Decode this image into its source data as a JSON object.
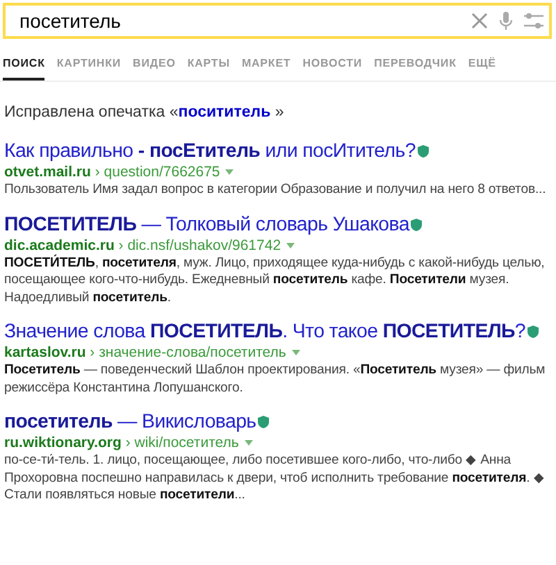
{
  "search": {
    "value": "посетитель"
  },
  "tabs": [
    {
      "label": "ПОИСК",
      "selected": true
    },
    {
      "label": "КАРТИНКИ",
      "selected": false
    },
    {
      "label": "ВИДЕО",
      "selected": false
    },
    {
      "label": "КАРТЫ",
      "selected": false
    },
    {
      "label": "МАРКЕТ",
      "selected": false
    },
    {
      "label": "НОВОСТИ",
      "selected": false
    },
    {
      "label": "ПЕРЕВОДЧИК",
      "selected": false
    },
    {
      "label": "ЕЩЁ",
      "selected": false
    }
  ],
  "correction": {
    "text": "Исправлена опечатка «",
    "query": "посититель",
    "end": " »"
  },
  "results": [
    {
      "title": "Как правильно **- посЕтитель** или посИтитель?",
      "url": "**otvet.mail.ru** › question/7662675",
      "snippet": "Пользователь Имя задал вопрос в категории Образование и получил на него 8 ответов..."
    },
    {
      "title": "**ПОСЕТИТЕЛЬ** — Толковый словарь Ушакова",
      "url": "**dic.academic.ru** › dic.nsf/ushakov/961742",
      "snippet": "**ПОСЕТИ́ТЕЛЬ**, **посетителя**, муж. Лицо, приходящее куда-нибудь с какой-нибудь целью, посещающее кого-что-нибудь. Ежедневный **посетитель** кафе. **Посетители** музея. Надоедливый **посетитель**."
    },
    {
      "title": "Значение слова **ПОСЕТИТЕЛЬ**. Что такое **ПОСЕТИТЕЛЬ**?",
      "url": "**kartaslov.ru** › значение-слова/посетитель",
      "snippet": "**Посетитель** — поведенческий Шаблон проектирования. «**Посетитель** музея» — фильм режиссёра Константина Лопушанского."
    },
    {
      "title": "**посетитель** — Викисловарь",
      "url": "**ru.wiktionary.org** › wiki/посетитель",
      "snippet": "по-се-ти́-тель. 1. лицо, посещающее, либо посетившее кого-либо, что-либо ◆ Анна Прохоровна поспешно направилась к двери, чтоб исполнить требование **посетителя**. ◆ Стали появляться новые **посетители**..."
    }
  ]
}
